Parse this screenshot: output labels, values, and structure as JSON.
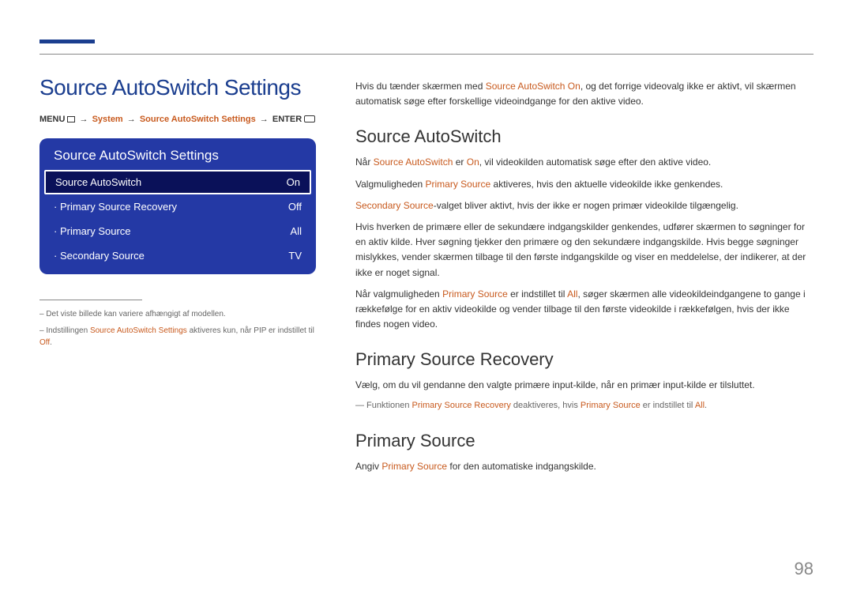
{
  "pageNumber": "98",
  "leftCol": {
    "title": "Source AutoSwitch Settings",
    "breadcrumb": {
      "menu": "MENU",
      "system": "System",
      "settings": "Source AutoSwitch Settings",
      "enter": "ENTER"
    },
    "panel": {
      "title": "Source AutoSwitch Settings",
      "rows": [
        {
          "label": "Source AutoSwitch",
          "value": "On"
        },
        {
          "label": "· Primary Source Recovery",
          "value": "Off"
        },
        {
          "label": "· Primary Source",
          "value": "All"
        },
        {
          "label": "· Secondary Source",
          "value": "TV"
        }
      ]
    },
    "notes": {
      "n1": "– Det viste billede kan variere afhængigt af modellen.",
      "n2a": "– Indstillingen ",
      "n2b": "Source AutoSwitch Settings",
      "n2c": " aktiveres kun, når PIP er indstillet til ",
      "n2d": "Off",
      "n2e": "."
    }
  },
  "rightCol": {
    "intro": {
      "a": "Hvis du tænder skærmen med ",
      "b": "Source AutoSwitch On",
      "c": ", og det forrige videovalg ikke er aktivt, vil skærmen automatisk søge efter forskellige videoindgange for den aktive video."
    },
    "h_autoswitch": "Source AutoSwitch",
    "p1": {
      "a": "Når ",
      "b": "Source AutoSwitch",
      "c": " er ",
      "d": "On",
      "e": ", vil videokilden automatisk søge efter den aktive video."
    },
    "p2": {
      "a": "Valgmuligheden ",
      "b": "Primary Source",
      "c": " aktiveres, hvis den aktuelle videokilde ikke genkendes."
    },
    "p3": {
      "a": "Secondary Source",
      "b": "-valget bliver aktivt, hvis der ikke er nogen primær videokilde tilgængelig."
    },
    "p4": "Hvis hverken de primære eller de sekundære indgangskilder genkendes, udfører skærmen to søgninger for en aktiv kilde. Hver søgning tjekker den primære og den sekundære indgangskilde. Hvis begge søgninger mislykkes, vender skærmen tilbage til den første indgangskilde og viser en meddelelse, der indikerer, at der ikke er noget signal.",
    "p5": {
      "a": "Når valgmuligheden ",
      "b": "Primary Source",
      "c": " er indstillet til ",
      "d": "All",
      "e": ", søger skærmen alle videokildeindgangene to gange i rækkefølge for en aktiv videokilde og vender tilbage til den første videokilde i rækkefølgen, hvis der ikke findes nogen video."
    },
    "h_recovery": "Primary Source Recovery",
    "p_recovery": "Vælg, om du vil gendanne den valgte primære input-kilde, når en primær input-kilde er tilsluttet.",
    "sub_recovery": {
      "a": "― Funktionen ",
      "b": "Primary Source Recovery",
      "c": " deaktiveres, hvis ",
      "d": "Primary Source",
      "e": " er indstillet til ",
      "f": "All",
      "g": "."
    },
    "h_primary": "Primary Source",
    "p_primary": {
      "a": "Angiv ",
      "b": "Primary Source",
      "c": " for den automatiske indgangskilde."
    }
  }
}
